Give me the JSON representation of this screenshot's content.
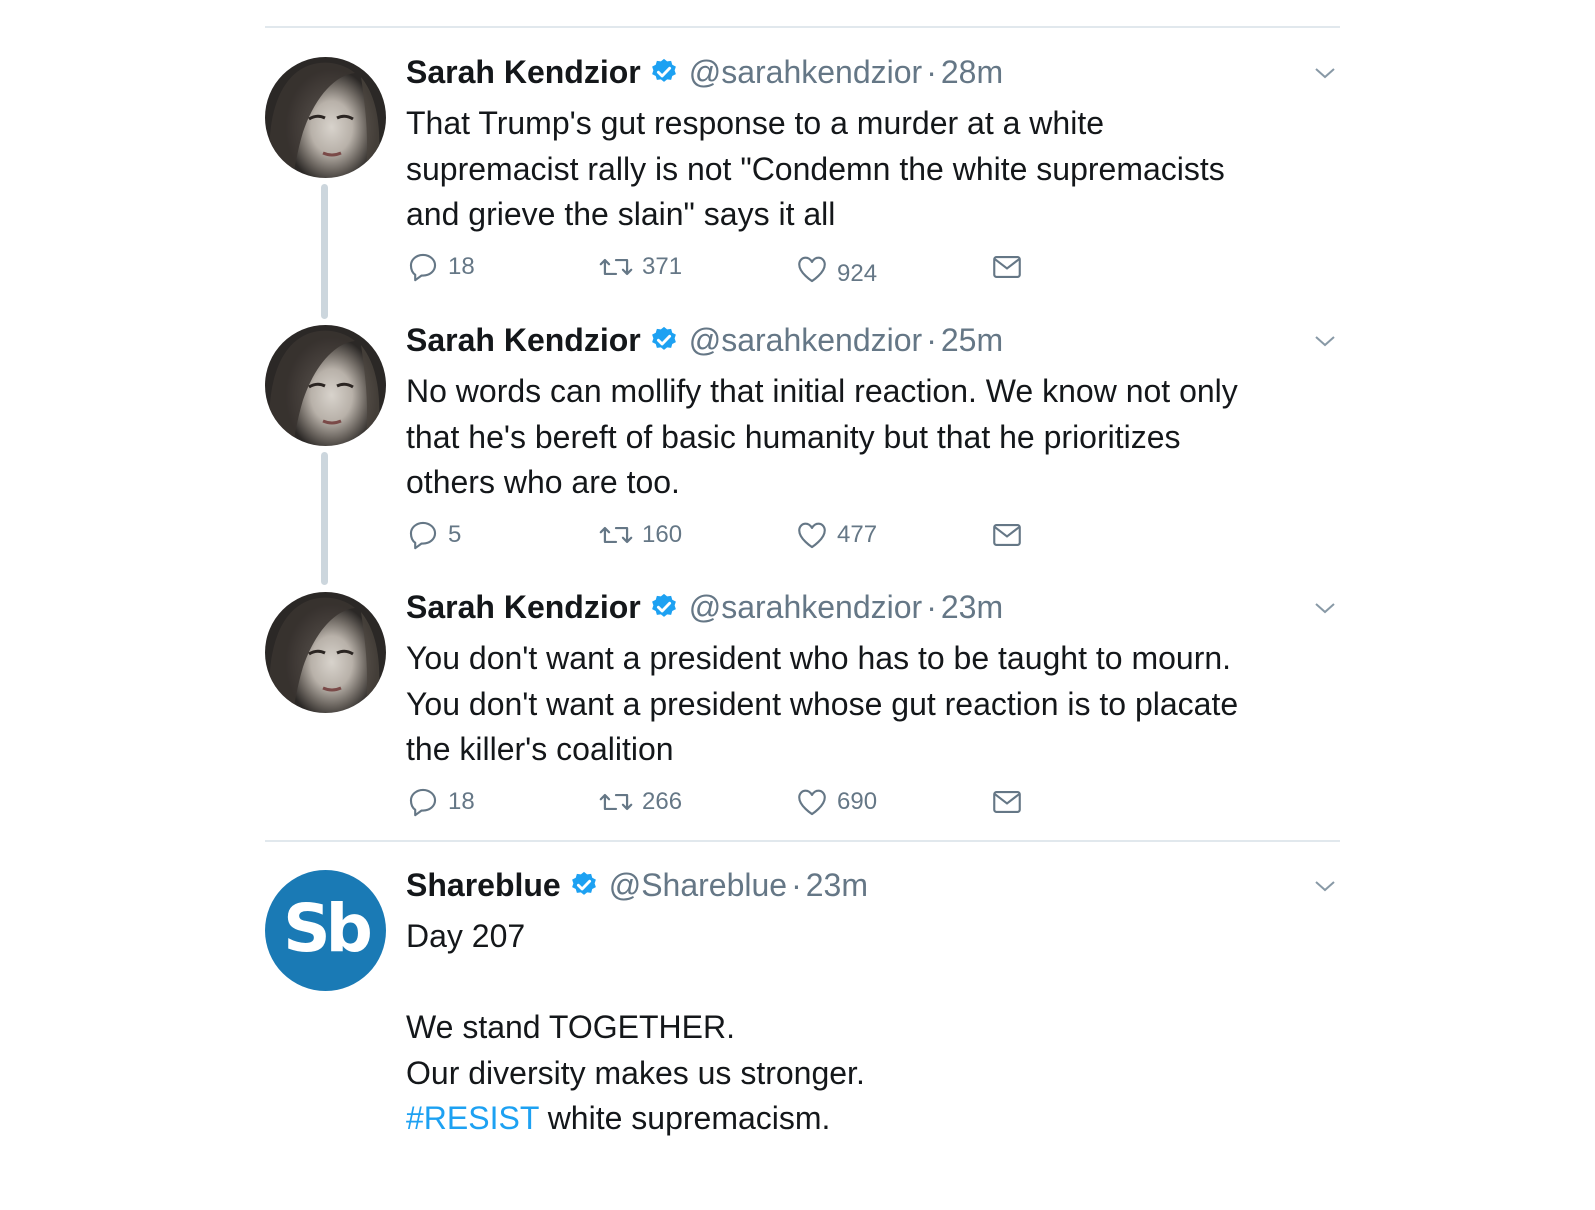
{
  "tweets": [
    {
      "name": "Sarah Kendzior",
      "handle": "@sarahkendzior",
      "dot": "·",
      "time": "28m",
      "text": "That Trump's gut response to a murder at a white\nsupremacist rally is not \"Condemn the white supremacists\nand grieve the slain\" says it all",
      "replies": "18",
      "retweets": "371",
      "likes": "924"
    },
    {
      "name": "Sarah Kendzior",
      "handle": "@sarahkendzior",
      "dot": "·",
      "time": "25m",
      "text": "No words can mollify that initial reaction. We know not only\nthat he's bereft of basic humanity but that he prioritizes\nothers who are too.",
      "replies": "5",
      "retweets": "160",
      "likes": "477"
    },
    {
      "name": "Sarah Kendzior",
      "handle": "@sarahkendzior",
      "dot": "·",
      "time": "23m",
      "text": "You don't want a president who has to be taught to mourn.\nYou don't want a president whose gut reaction is to placate\nthe killer's coalition",
      "replies": "18",
      "retweets": "266",
      "likes": "690"
    },
    {
      "name": "Shareblue",
      "handle": "@Shareblue",
      "dot": "·",
      "time": "23m",
      "avatar_text": "Sb",
      "text": "Day 207\n\nWe stand TOGETHER.\nOur diversity makes us stronger.\n",
      "hashtag": "#RESIST",
      "text_tail": " white supremacism."
    }
  ],
  "colors": {
    "verified": "#1da1f2",
    "hashtag": "#1da1f2",
    "secondary_text": "#657786",
    "thread_line": "#ccd6dd",
    "shareblue_avatar": "#1a7ab5"
  },
  "icons": [
    "verified-badge-icon",
    "chevron-down-icon",
    "reply-icon",
    "retweet-icon",
    "like-icon",
    "direct-message-icon"
  ]
}
